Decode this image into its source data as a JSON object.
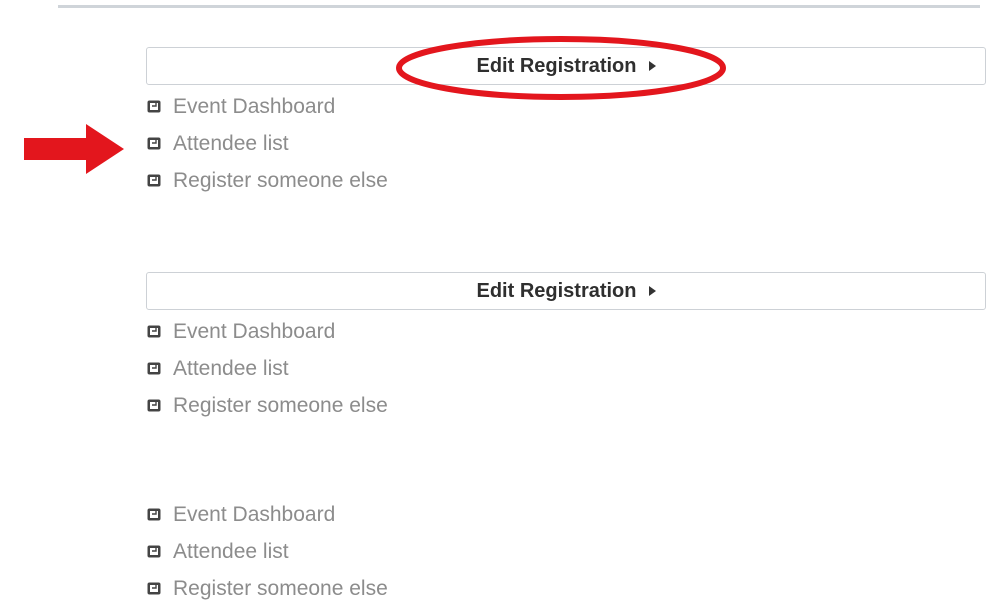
{
  "colors": {
    "annotation": "#e3161d",
    "link_text": "#8c8c8c",
    "button_text": "#2f2f2f",
    "border": "#cdd1d6"
  },
  "icons": {
    "link_icon": "external-link-icon",
    "button_caret": "play-caret-icon"
  },
  "blocks": [
    {
      "edit_button_label": "Edit Registration",
      "links": [
        "Event Dashboard",
        "Attendee list",
        "Register someone else"
      ]
    },
    {
      "edit_button_label": "Edit Registration",
      "links": [
        "Event Dashboard",
        "Attendee list",
        "Register someone else"
      ]
    },
    {
      "links": [
        "Event Dashboard",
        "Attendee list",
        "Register someone else"
      ]
    }
  ],
  "annotations": {
    "arrow": "pointing-arrow",
    "circle": "highlight-ellipse"
  }
}
